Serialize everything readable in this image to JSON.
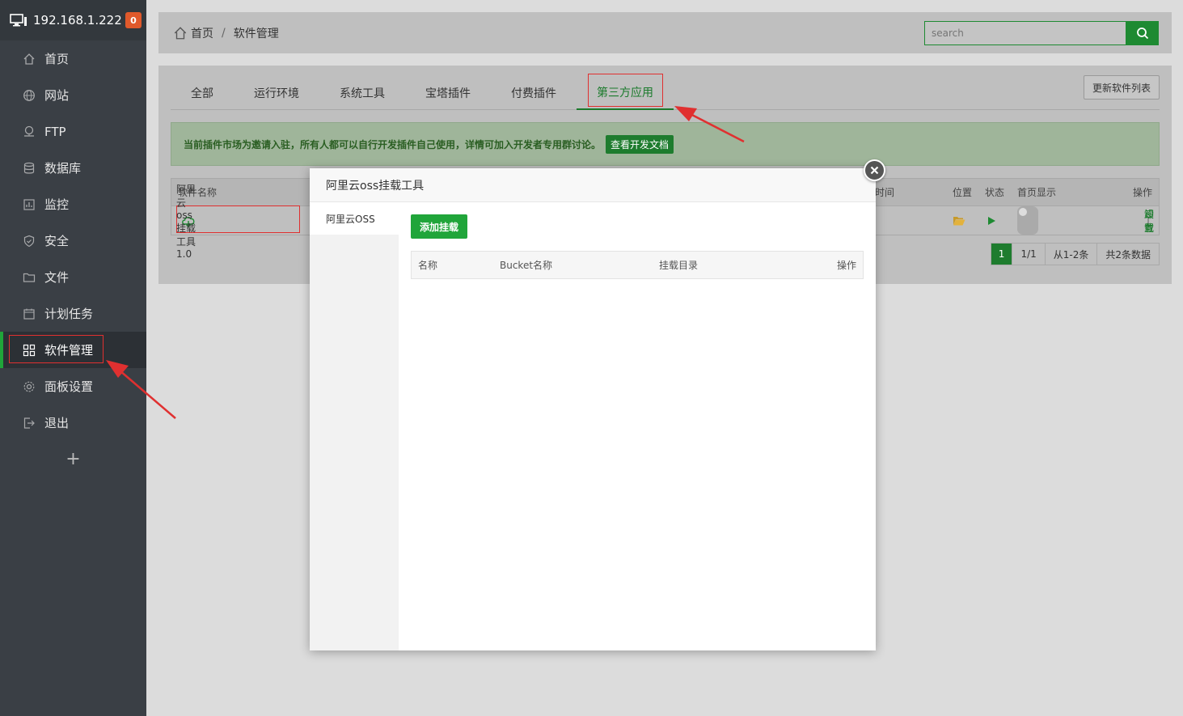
{
  "sidebar": {
    "ip": "192.168.1.222",
    "badge": "0",
    "items": [
      {
        "label": "首页",
        "icon": "home-icon"
      },
      {
        "label": "网站",
        "icon": "globe-icon"
      },
      {
        "label": "FTP",
        "icon": "ftp-icon"
      },
      {
        "label": "数据库",
        "icon": "database-icon"
      },
      {
        "label": "监控",
        "icon": "monitor-icon"
      },
      {
        "label": "安全",
        "icon": "shield-icon"
      },
      {
        "label": "文件",
        "icon": "folder-icon"
      },
      {
        "label": "计划任务",
        "icon": "calendar-icon"
      },
      {
        "label": "软件管理",
        "icon": "apps-icon"
      },
      {
        "label": "面板设置",
        "icon": "gear-icon"
      },
      {
        "label": "退出",
        "icon": "logout-icon"
      }
    ],
    "add_label": "+"
  },
  "breadcrumb": {
    "home": "首页",
    "separator": "/",
    "current": "软件管理"
  },
  "search": {
    "placeholder": "search"
  },
  "tabs": [
    {
      "label": "全部"
    },
    {
      "label": "运行环境"
    },
    {
      "label": "系统工具"
    },
    {
      "label": "宝塔插件"
    },
    {
      "label": "付费插件"
    },
    {
      "label": "第三方应用"
    }
  ],
  "update_button": "更新软件列表",
  "notice": {
    "text": "当前插件市场为邀请入驻，所有人都可以自行开发插件自己使用，详情可加入开发者专用群讨论。",
    "doc_button": "查看开发文档"
  },
  "soft_table": {
    "headers": {
      "name": "软件名称",
      "time": "时间",
      "location": "位置",
      "status": "状态",
      "home_display": "首页显示",
      "action": "操作"
    },
    "rows": [
      {
        "name": "阿里云oss挂载工具 1.0",
        "settings": "设置",
        "divider": "|",
        "uninstall": "卸载"
      }
    ]
  },
  "pager": {
    "current": "1",
    "pages": "1/1",
    "range": "从1-2条",
    "total": "共2条数据"
  },
  "modal": {
    "title": "阿里云oss挂载工具",
    "side_item": "阿里云OSS",
    "add_button": "添加挂载",
    "headers": {
      "name": "名称",
      "bucket": "Bucket名称",
      "mount_dir": "挂载目录",
      "action": "操作"
    }
  },
  "colors": {
    "accent": "#20a53a",
    "annotation": "#e03030"
  }
}
